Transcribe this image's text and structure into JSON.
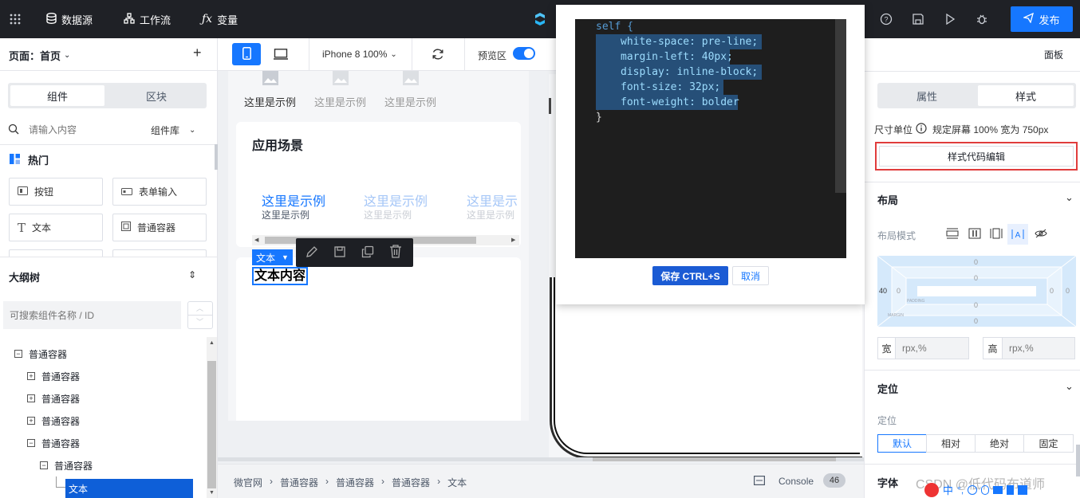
{
  "topbar": {
    "datasource": "数据源",
    "workflow": "工作流",
    "variable": "变量",
    "publish": "发布"
  },
  "left": {
    "page_label": "页面：首页",
    "tab_components": "组件",
    "tab_blocks": "区块",
    "search_placeholder": "请输入内容",
    "library": "组件库",
    "hot": "热门",
    "components": [
      "按钮",
      "表单输入",
      "文本",
      "普通容器"
    ],
    "outline_title": "大纲树",
    "outline_search_placeholder": "可搜索组件名称 / ID",
    "tree": [
      "普通容器",
      "普通容器",
      "普通容器",
      "普通容器",
      "普通容器",
      "普通容器",
      "文本"
    ]
  },
  "canvas": {
    "device": "iPhone 8 100%",
    "preview": "预览区",
    "examples_top": [
      "这里是示例",
      "这里是示例",
      "这里是示例"
    ],
    "scene_title": "应用场景",
    "examples_main": [
      "这里是示例",
      "这里是示例",
      "这里是示"
    ],
    "examples_sub": [
      "这里是示例",
      "这里是示例",
      "这里是示例"
    ],
    "selected_tag": "文本",
    "text_content": "文本内容",
    "breadcrumb": [
      "微官网",
      "普通容器",
      "普通容器",
      "普通容器",
      "文本"
    ],
    "console": "Console",
    "console_count": "46"
  },
  "modal": {
    "code_lines": [
      "self {",
      "white-space: pre-line;",
      "margin-left: 40px;",
      "display: inline-block;",
      "font-size: 32px;",
      "font-weight: bolder",
      "}"
    ],
    "save": "保存 CTRL+S",
    "cancel": "取消"
  },
  "right": {
    "panel_label": "面板",
    "tab_props": "属性",
    "tab_style": "样式",
    "unit_label": "尺寸单位",
    "unit_value": "规定屏幕 100% 宽为 750px",
    "style_code_btn": "样式代码编辑",
    "layout_title": "布局",
    "layout_mode": "布局模式",
    "box_values": {
      "margin_top": "0",
      "padding_top": "0",
      "margin_left": "40",
      "padding_left": "0",
      "padding_right": "0",
      "margin_right": "0",
      "padding_bottom": "0",
      "margin_bottom": "0"
    },
    "box_padding_label": "PADDING",
    "box_margin_label": "MARGIN",
    "width_label": "宽",
    "height_label": "高",
    "width_placeholder": "rpx,%",
    "height_placeholder": "rpx,%",
    "position_title": "定位",
    "position_label": "定位",
    "position_options": [
      "默认",
      "相对",
      "绝对",
      "固定"
    ],
    "font_title": "字体"
  },
  "watermark": "CSDN @低代码布道师"
}
